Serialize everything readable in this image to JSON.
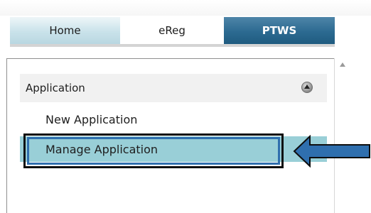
{
  "tabs": [
    {
      "label": "Home"
    },
    {
      "label": "eReg"
    },
    {
      "label": "PTWS"
    }
  ],
  "sidebar": {
    "section_title": "Application",
    "items": [
      {
        "label": "New Application"
      },
      {
        "label": "Manage Application"
      }
    ]
  },
  "colors": {
    "active_tab": "#2c6a91",
    "selected_item": "#99cfd7",
    "annotation_arrow": "#2f6fae"
  },
  "icons": {
    "collapse": "chevron-up-circle-icon",
    "scroll": "scroll-up-icon",
    "annotation": "left-arrow-icon"
  }
}
